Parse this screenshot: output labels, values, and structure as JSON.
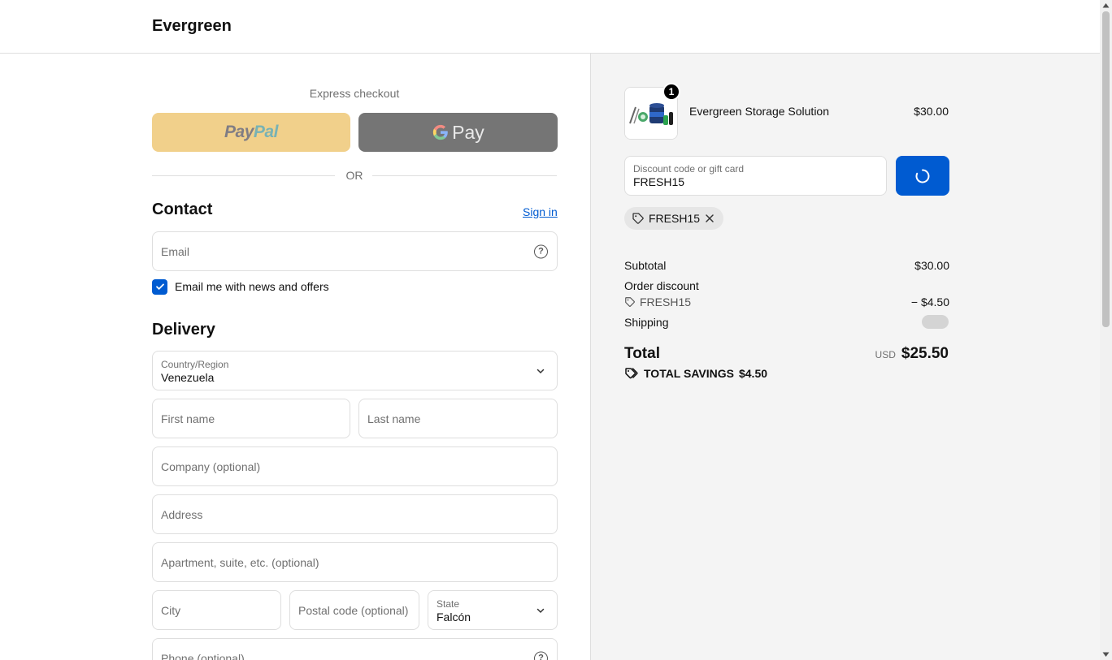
{
  "header": {
    "brand": "Evergreen"
  },
  "express": {
    "title": "Express checkout",
    "paypal_a": "Pay",
    "paypal_b": "Pal",
    "gpay_label": "Pay",
    "or_text": "OR"
  },
  "contact": {
    "title": "Contact",
    "signin": "Sign in",
    "email_placeholder": "Email",
    "newsletter_label": "Email me with news and offers",
    "newsletter_checked": true
  },
  "delivery": {
    "title": "Delivery",
    "country_label": "Country/Region",
    "country_value": "Venezuela",
    "first_name": "First name",
    "last_name": "Last name",
    "company": "Company (optional)",
    "address": "Address",
    "apartment": "Apartment, suite, etc. (optional)",
    "city": "City",
    "postal": "Postal code (optional)",
    "state_label": "State",
    "state_value": "Falcón",
    "phone": "Phone (optional)"
  },
  "summary": {
    "product_name": "Evergreen Storage Solution",
    "product_price": "$30.00",
    "quantity": "1",
    "discount_label": "Discount code or gift card",
    "discount_value": "FRESH15",
    "applied_code": "FRESH15",
    "subtotal_label": "Subtotal",
    "subtotal_value": "$30.00",
    "order_discount_label": "Order discount",
    "order_discount_code": "FRESH15",
    "order_discount_value": "− $4.50",
    "shipping_label": "Shipping",
    "total_label": "Total",
    "total_currency": "USD",
    "total_value": "$25.50",
    "savings_label": "TOTAL SAVINGS",
    "savings_value": "$4.50"
  },
  "colors": {
    "accent": "#005bd1",
    "paypal_bg": "#f1d08b",
    "gpay_bg": "#757575",
    "summary_bg": "#f4f4f4"
  }
}
